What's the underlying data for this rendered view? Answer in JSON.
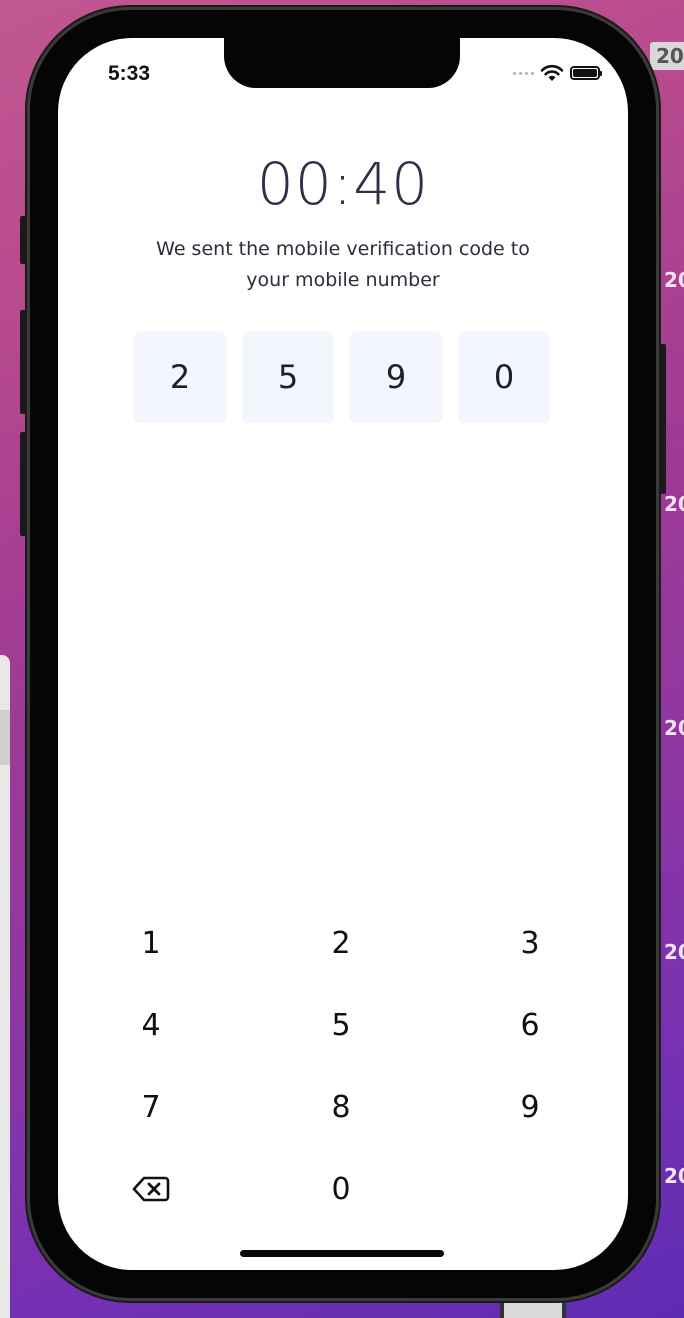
{
  "status_bar": {
    "time": "5:33"
  },
  "verification": {
    "timer": "00:40",
    "message_line1": "We sent the mobile verification code to",
    "message_line2": "your mobile number",
    "code_digits": [
      "2",
      "5",
      "9",
      "0"
    ]
  },
  "keypad": {
    "keys": [
      "1",
      "2",
      "3",
      "4",
      "5",
      "6",
      "7",
      "8",
      "9",
      "0"
    ],
    "backspace_icon": "backspace-icon"
  },
  "desktop": {
    "badge_text": "20",
    "labels": [
      "20",
      "20",
      "20",
      "20",
      "20"
    ]
  },
  "colors": {
    "timer_text": "#2c3149",
    "code_cell_bg": "#f3f6fc"
  }
}
